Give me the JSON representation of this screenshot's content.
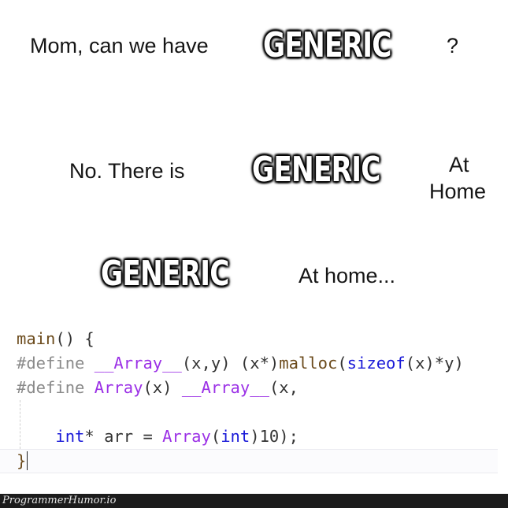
{
  "meme": {
    "panel1": {
      "text": "Mom, can we have",
      "generic": "GENERIC",
      "suffix": "?"
    },
    "panel2": {
      "text": "No. There is",
      "generic": "GENERIC",
      "suffix_line1": "At",
      "suffix_line2": "Home"
    },
    "panel3": {
      "generic": "GENERIC",
      "text": "At home..."
    }
  },
  "code": {
    "lines": [
      {
        "tokens": [
          {
            "t": "main",
            "c": "fn"
          },
          {
            "t": "() {",
            "c": "plain"
          }
        ]
      },
      {
        "tokens": [
          {
            "t": "#define ",
            "c": "pre"
          },
          {
            "t": "__Array__",
            "c": "macro"
          },
          {
            "t": "(x,y) (x*)",
            "c": "plain"
          },
          {
            "t": "malloc",
            "c": "fn"
          },
          {
            "t": "(",
            "c": "plain"
          },
          {
            "t": "sizeof",
            "c": "kw"
          },
          {
            "t": "(x)*y)",
            "c": "plain"
          }
        ]
      },
      {
        "tokens": [
          {
            "t": "#define ",
            "c": "pre"
          },
          {
            "t": "Array",
            "c": "macro"
          },
          {
            "t": "(x) ",
            "c": "plain"
          },
          {
            "t": "__Array__",
            "c": "macro"
          },
          {
            "t": "(x,",
            "c": "plain"
          }
        ]
      },
      {
        "tokens": []
      },
      {
        "tokens": [
          {
            "t": "    ",
            "c": "plain"
          },
          {
            "t": "int",
            "c": "kw"
          },
          {
            "t": "* arr = ",
            "c": "plain"
          },
          {
            "t": "Array",
            "c": "macro"
          },
          {
            "t": "(",
            "c": "plain"
          },
          {
            "t": "int",
            "c": "kw"
          },
          {
            "t": ")10);",
            "c": "plain"
          }
        ]
      },
      {
        "tokens": [
          {
            "t": "}",
            "c": "fn"
          }
        ],
        "current": true
      }
    ]
  },
  "watermark": "ProgrammerHumor.io",
  "colors": {
    "macro": "#9b30e6",
    "keyword": "#1a1ad8",
    "function": "#6b4a1b",
    "preprocessor": "#8a8a8a",
    "footer_bg": "#1c1c1c"
  }
}
